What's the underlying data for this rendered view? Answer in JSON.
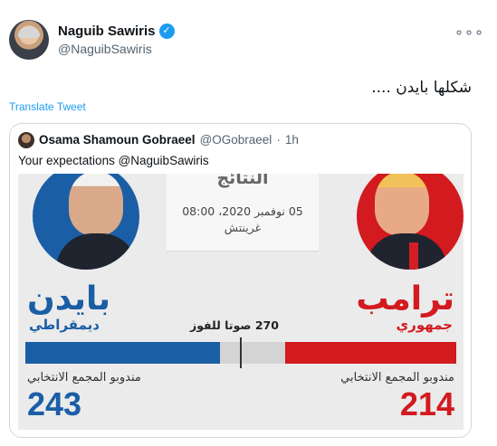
{
  "author": {
    "name": "Naguib Sawiris",
    "handle": "@NaguibSawiris",
    "verified_icon": "✓"
  },
  "menu": {
    "more_label": "∘∘∘"
  },
  "tweet": {
    "text": "شكلها بايدن ....",
    "translate_label": "Translate Tweet"
  },
  "quoted": {
    "name": "Osama Shamoun Gobraeel",
    "handle": "@OGobraeel",
    "separator": "·",
    "time": "1h",
    "text": "Your expectations @NaguibSawiris"
  },
  "graphic": {
    "title": "النتائج",
    "date": "05 نوفمبر 2020، 08:00",
    "timezone": "غرينتش",
    "threshold_label": "270 صوتا للفوز",
    "biden": {
      "name": "بايدن",
      "party": "ديمقراطي",
      "electors_label": "مندوبو المجمع الانتخابي",
      "electoral_votes": "243",
      "color": "#1a5ea6"
    },
    "trump": {
      "name": "ترامب",
      "party": "جمهوري",
      "electors_label": "مندوبو المجمع الانتخابي",
      "electoral_votes": "214",
      "color": "#d21a1f"
    }
  }
}
